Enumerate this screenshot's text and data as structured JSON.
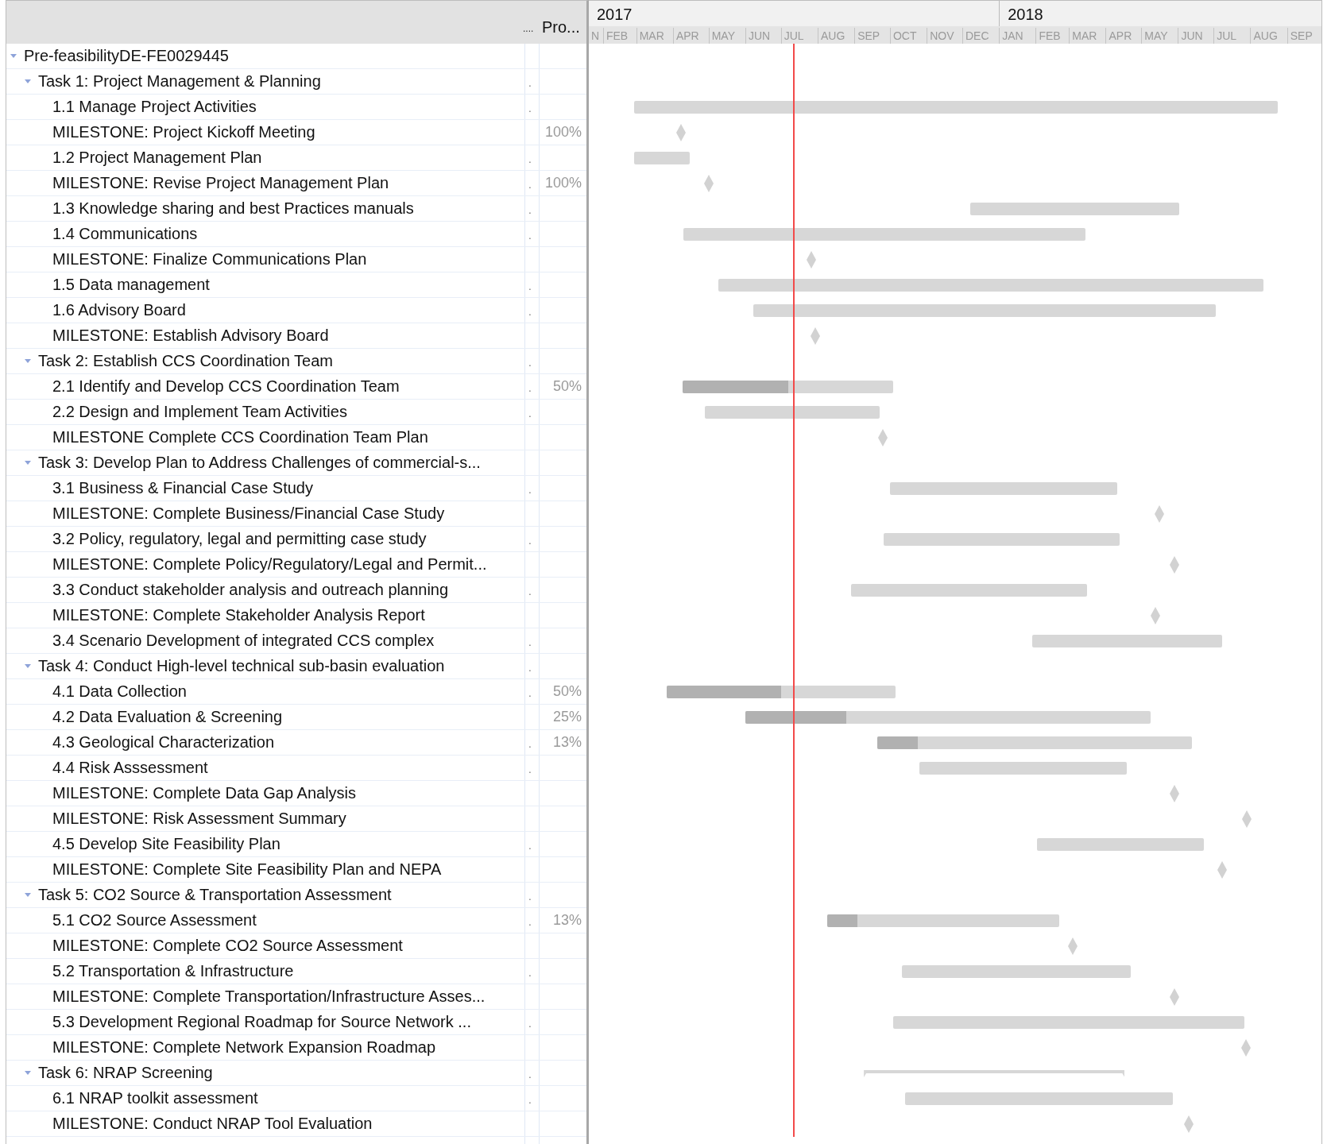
{
  "columns": {
    "narrow": "....",
    "progress": "Pro..."
  },
  "timeline": {
    "years": [
      {
        "label": "2017"
      },
      {
        "label": "2018"
      }
    ],
    "months": [
      {
        "label": "N"
      },
      {
        "label": "FEB"
      },
      {
        "label": "MAR"
      },
      {
        "label": "APR"
      },
      {
        "label": "MAY"
      },
      {
        "label": "JUN"
      },
      {
        "label": "JUL"
      },
      {
        "label": "AUG"
      },
      {
        "label": "SEP"
      },
      {
        "label": "OCT"
      },
      {
        "label": "NOV"
      },
      {
        "label": "DEC"
      },
      {
        "label": "JAN"
      },
      {
        "label": "FEB"
      },
      {
        "label": "MAR"
      },
      {
        "label": "APR"
      },
      {
        "label": "MAY"
      },
      {
        "label": "JUN"
      },
      {
        "label": "JUL"
      },
      {
        "label": "AUG"
      },
      {
        "label": "SEP"
      }
    ]
  },
  "tree": [
    {
      "name": "Pre-feasibilityDE-FE0029445",
      "kind": "group",
      "expanded": true,
      "children": [
        {
          "name": "Task 1: Project Management & Planning",
          "kind": "group",
          "expanded": true,
          "narrow": ".",
          "children": [
            {
              "name": "1.1 Manage Project Activities",
              "kind": "task",
              "narrow": "."
            },
            {
              "name": "MILESTONE: Project Kickoff Meeting",
              "kind": "milestone",
              "progress": "100%"
            },
            {
              "name": "1.2 Project Management Plan",
              "kind": "task",
              "narrow": "."
            },
            {
              "name": "MILESTONE: Revise Project Management Plan",
              "kind": "milestone",
              "narrow": ".",
              "progress": "100%"
            },
            {
              "name": "1.3 Knowledge sharing and best Practices manuals",
              "kind": "task",
              "narrow": "."
            },
            {
              "name": "1.4 Communications",
              "kind": "task",
              "narrow": "."
            },
            {
              "name": "MILESTONE: Finalize Communications Plan",
              "kind": "milestone"
            },
            {
              "name": "1.5 Data management",
              "kind": "task",
              "narrow": "."
            },
            {
              "name": "1.6 Advisory Board",
              "kind": "task",
              "narrow": "."
            },
            {
              "name": "MILESTONE: Establish Advisory Board",
              "kind": "milestone"
            }
          ]
        },
        {
          "name": "Task 2: Establish CCS Coordination Team",
          "kind": "group",
          "expanded": true,
          "narrow": ".",
          "children": [
            {
              "name": "2.1 Identify and Develop CCS Coordination Team",
              "kind": "task",
              "narrow": ".",
              "progress": "50%",
              "level": 0.5
            },
            {
              "name": "2.2 Design and Implement Team Activities",
              "kind": "task",
              "narrow": "."
            },
            {
              "name": "MILESTONE Complete CCS Coordination Team Plan",
              "kind": "milestone"
            }
          ]
        },
        {
          "name": "Task 3: Develop Plan to Address Challenges of commercial-s...",
          "kind": "group",
          "expanded": true,
          "children": [
            {
              "name": "3.1 Business & Financial Case Study",
              "kind": "task",
              "narrow": "."
            },
            {
              "name": "MILESTONE: Complete Business/Financial Case Study",
              "kind": "milestone"
            },
            {
              "name": "3.2 Policy, regulatory, legal and permitting case study",
              "kind": "task",
              "narrow": "."
            },
            {
              "name": "MILESTONE:  Complete Policy/Regulatory/Legal and Permit...",
              "kind": "milestone"
            },
            {
              "name": "3.3 Conduct stakeholder analysis and  outreach planning",
              "kind": "task",
              "narrow": "."
            },
            {
              "name": "MILESTONE: Complete Stakeholder Analysis Report",
              "kind": "milestone"
            },
            {
              "name": "3.4 Scenario Development of integrated CCS complex",
              "kind": "task",
              "narrow": "."
            }
          ]
        },
        {
          "name": "Task 4: Conduct High-level technical sub-basin evaluation",
          "kind": "group",
          "expanded": true,
          "narrow": ".",
          "children": [
            {
              "name": "4.1 Data Collection",
              "kind": "task",
              "narrow": ".",
              "progress": "50%",
              "level": 0.5
            },
            {
              "name": "4.2 Data Evaluation & Screening",
              "kind": "task",
              "progress": "25%",
              "level": 0.25
            },
            {
              "name": "4.3 Geological Characterization",
              "kind": "task",
              "narrow": ".",
              "progress": "13%",
              "level": 0.13
            },
            {
              "name": "4.4 Risk Asssessment",
              "kind": "task",
              "narrow": "."
            },
            {
              "name": "MILESTONE: Complete Data Gap Analysis",
              "kind": "milestone"
            },
            {
              "name": "MILESTONE: Risk Assessment Summary",
              "kind": "milestone"
            },
            {
              "name": "4.5 Develop Site Feasibility Plan",
              "kind": "task",
              "narrow": "."
            },
            {
              "name": "MILESTONE: Complete Site Feasibility Plan and NEPA",
              "kind": "milestone"
            }
          ]
        },
        {
          "name": "Task 5: CO2 Source & Transportation Assessment",
          "kind": "group",
          "expanded": true,
          "narrow": ".",
          "children": [
            {
              "name": "5.1 CO2 Source Assessment",
              "kind": "task",
              "narrow": ".",
              "progress": "13%",
              "level": 0.13
            },
            {
              "name": "MILESTONE: Complete CO2 Source Assessment",
              "kind": "milestone"
            },
            {
              "name": "5.2 Transportation & Infrastructure",
              "kind": "task",
              "narrow": "."
            },
            {
              "name": "MILESTONE: Complete Transportation/Infrastructure Asses...",
              "kind": "milestone"
            },
            {
              "name": "5.3 Development Regional Roadmap for Source Network ...",
              "kind": "task",
              "narrow": "."
            },
            {
              "name": "MILESTONE: Complete Network Expansion Roadmap",
              "kind": "milestone"
            }
          ]
        },
        {
          "name": "Task 6:  NRAP Screening",
          "kind": "group",
          "expanded": true,
          "narrow": ".",
          "children": [
            {
              "name": "6.1 NRAP toolkit assessment",
              "kind": "task",
              "narrow": "."
            },
            {
              "name": "MILESTONE: Conduct NRAP Tool Evaluation",
              "kind": "milestone"
            }
          ]
        }
      ]
    }
  ]
}
